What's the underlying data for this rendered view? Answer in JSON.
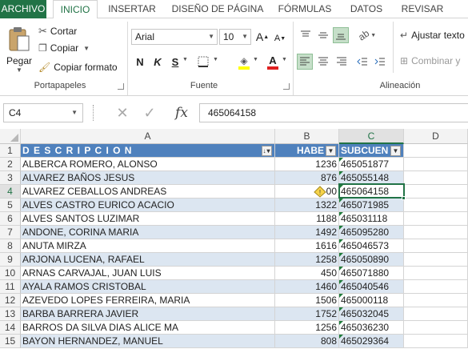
{
  "tabs": [
    "ARCHIVO",
    "INICIO",
    "INSERTAR",
    "DISEÑO DE PÁGINA",
    "FÓRMULAS",
    "DATOS",
    "REVISAR"
  ],
  "ribbon": {
    "clipboard": {
      "paste_label": "Pegar",
      "cut_label": "Cortar",
      "copy_label": "Copiar",
      "format_painter_label": "Copiar formato",
      "group_label": "Portapapeles"
    },
    "font": {
      "font_name": "Arial",
      "font_size": "10",
      "bold": "N",
      "italic": "K",
      "underline": "S",
      "grow": "A",
      "shrink": "A",
      "font_color_letter": "A",
      "group_label": "Fuente"
    },
    "alignment": {
      "wrap_text_label": "Ajustar texto",
      "merge_label": "Combinar y",
      "group_label": "Alineación"
    }
  },
  "formula_bar": {
    "name_box": "C4",
    "fx_label": "fx",
    "value": "465064158"
  },
  "sheet": {
    "columns": [
      "A",
      "B",
      "C",
      "D"
    ],
    "header_row": {
      "row": "1",
      "a": "D E S C R I P C I O N",
      "b": "HABE",
      "c": "SUBCUEN"
    },
    "rows": [
      {
        "row": "2",
        "a": "ALBERCA ROMERO, ALONSO",
        "b": "1236",
        "c": "465051877"
      },
      {
        "row": "3",
        "a": "ALVAREZ BAÑOS JESUS",
        "b": "876",
        "c": "465055148"
      },
      {
        "row": "4",
        "a": "ALVAREZ CEBALLOS ANDREAS",
        "b": "00",
        "c": "465064158"
      },
      {
        "row": "5",
        "a": "ALVES CASTRO EURICO ACACIO",
        "b": "1322",
        "c": "465071985"
      },
      {
        "row": "6",
        "a": "ALVES SANTOS LUZIMAR",
        "b": "1188",
        "c": "465031118"
      },
      {
        "row": "7",
        "a": "ANDONE, CORINA MARIA",
        "b": "1492",
        "c": "465095280"
      },
      {
        "row": "8",
        "a": "ANUTA MIRZA",
        "b": "1616",
        "c": "465046573"
      },
      {
        "row": "9",
        "a": "ARJONA LUCENA, RAFAEL",
        "b": "1258",
        "c": "465050890"
      },
      {
        "row": "10",
        "a": "ARNAS CARVAJAL, JUAN LUIS",
        "b": "450",
        "c": "465071880"
      },
      {
        "row": "11",
        "a": "AYALA RAMOS CRISTOBAL",
        "b": "1460",
        "c": "465040546"
      },
      {
        "row": "12",
        "a": "AZEVEDO LOPES FERREIRA, MARIA",
        "b": "1506",
        "c": "465000118"
      },
      {
        "row": "13",
        "a": "BARBA BARRERA JAVIER",
        "b": "1752",
        "c": "465032045"
      },
      {
        "row": "14",
        "a": "BARROS DA SILVA DIAS ALICE MA",
        "b": "1256",
        "c": "465036230"
      },
      {
        "row": "15",
        "a": "BAYON HERNANDEZ, MANUEL",
        "b": "808",
        "c": "465029364"
      }
    ]
  },
  "colors": {
    "excel_green": "#217346",
    "table_header": "#4f81bd",
    "band": "#dce6f1",
    "error_triangle": "#1f7b3a"
  }
}
